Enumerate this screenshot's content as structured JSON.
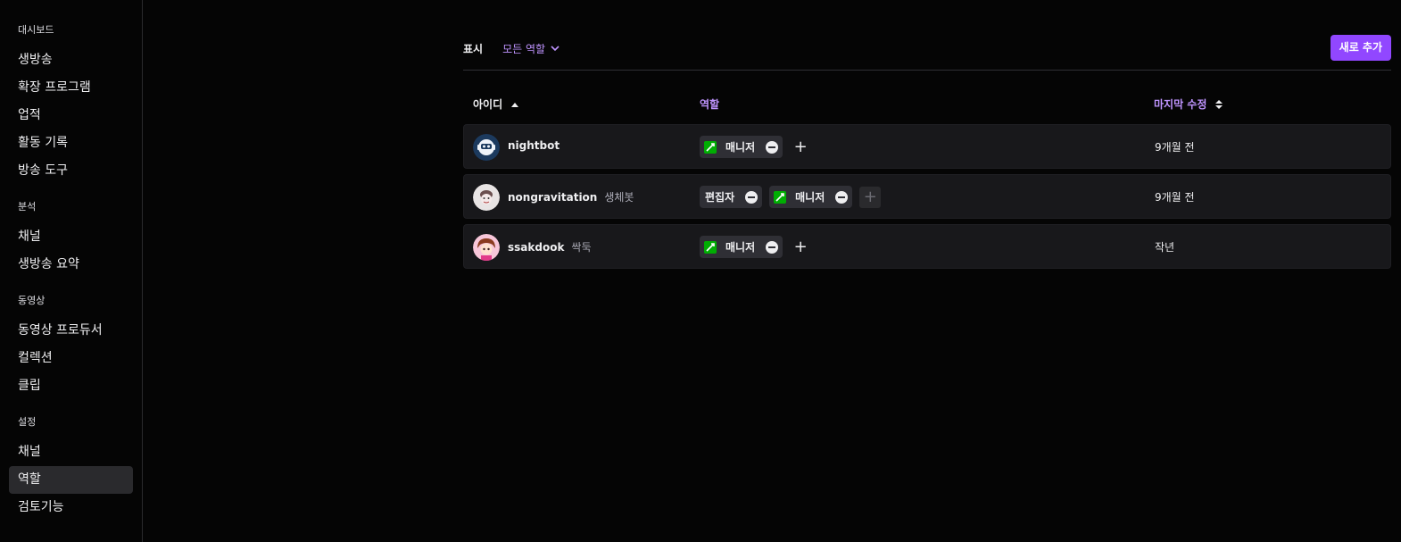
{
  "sidebar": {
    "sections": [
      {
        "title": "대시보드",
        "items": [
          "생방송",
          "확장 프로그램",
          "업적",
          "활동 기록",
          "방송 도구"
        ]
      },
      {
        "title": "분석",
        "items": [
          "채널",
          "생방송 요약"
        ]
      },
      {
        "title": "동영상",
        "items": [
          "동영상 프로듀서",
          "컬렉션",
          "클립"
        ]
      },
      {
        "title": "설정",
        "items": [
          "채널",
          "역할",
          "검토기능"
        ]
      }
    ]
  },
  "toolbar": {
    "filter_label": "표시",
    "filter_value": "모든 역할",
    "add_button": "새로 추가"
  },
  "table": {
    "headers": {
      "id": "아이디",
      "role": "역할",
      "modified": "마지막 수정"
    },
    "rows": [
      {
        "username": "nightbot",
        "display_name": "",
        "roles": [
          "매니저"
        ],
        "modified": "9개월 전"
      },
      {
        "username": "nongravitation",
        "display_name": "생체봇",
        "roles": [
          "편집자",
          "매니저"
        ],
        "modified": "9개월 전"
      },
      {
        "username": "ssakdook",
        "display_name": "싹둑",
        "roles": [
          "매니저"
        ],
        "modified": "작년"
      }
    ]
  },
  "colors": {
    "accent": "#9147ff",
    "accent_text": "#bf94ff",
    "moderator": "#00ad03",
    "row_bg": "#18181b"
  },
  "icons": {
    "sort_asc": "chevron-up-icon",
    "sort_both": "sort-icon",
    "dropdown": "chevron-down-icon",
    "moderator": "sword-icon",
    "remove": "minus-circle-icon",
    "add": "plus-icon"
  }
}
